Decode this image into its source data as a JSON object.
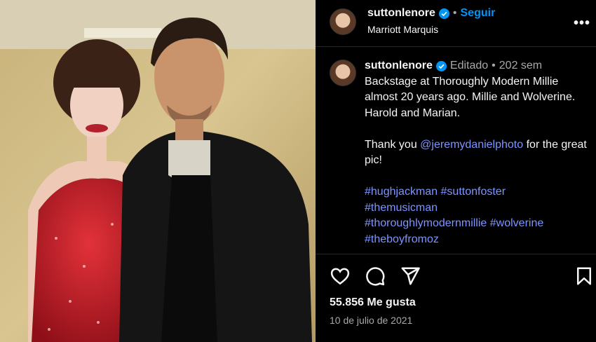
{
  "header": {
    "username": "suttonlenore",
    "separator": "•",
    "follow_label": "Seguir",
    "location": "Marriott Marquis",
    "more_label": "•••"
  },
  "caption": {
    "username": "suttonlenore",
    "edited": "Editado",
    "separator": "•",
    "age": "202 sem",
    "lines": {
      "p1": "Backstage at Thoroughly Modern Millie almost 20 years ago. Millie and Wolverine. Harold and Marian.",
      "p2_pre": "Thank you ",
      "mention": "@jeremydanielphoto",
      "p2_post": " for the great pic!"
    },
    "hashtags": [
      "#hughjackman",
      "#suttonfoster",
      "#themusicman",
      "#thoroughlymodernmillie",
      "#wolverine",
      "#theboyfromoz"
    ]
  },
  "actions": {
    "likes": "55.856 Me gusta",
    "date": "10 de julio de 2021"
  },
  "icons": [
    "heart-icon",
    "comment-icon",
    "share-icon",
    "bookmark-icon",
    "verified-badge-icon"
  ],
  "colors": {
    "accent": "#0095f6",
    "link": "#7c95ff",
    "muted": "#a8a8a8",
    "background": "#000000"
  }
}
